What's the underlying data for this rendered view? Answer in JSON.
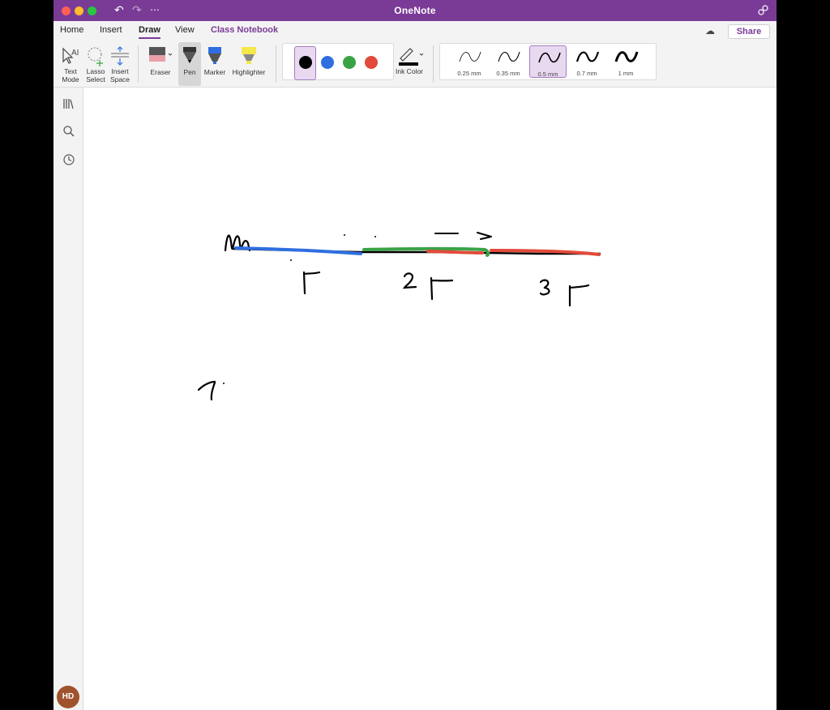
{
  "window": {
    "title": "OneNote"
  },
  "tabs": [
    "Home",
    "Insert",
    "Draw",
    "View",
    "Class Notebook"
  ],
  "share_label": "Share",
  "ribbon": {
    "text_mode": "Text Mode",
    "lasso_select": "Lasso Select",
    "insert_space": "Insert Space",
    "eraser": "Eraser",
    "pen": "Pen",
    "marker": "Marker",
    "highlighter": "Highlighter",
    "ink_color": "Ink Color",
    "stroke_sizes": [
      "0.25 mm",
      "0.35 mm",
      "0.5 mm",
      "0.7 mm",
      "1 mm"
    ],
    "selected_stroke": "0.5 mm"
  },
  "colors": {
    "accent": "#7a3b97",
    "ink_black": "#000000",
    "ink_blue": "#2f6fe0",
    "ink_green": "#3aa345",
    "ink_red": "#e24a3b"
  },
  "user": {
    "initials": "HD"
  },
  "icons": {
    "sidebar": [
      "notebooks-icon",
      "search-icon",
      "recent-icon"
    ],
    "titlebar": [
      "undo-icon",
      "redo-icon",
      "more-icon",
      "account-icon"
    ]
  }
}
